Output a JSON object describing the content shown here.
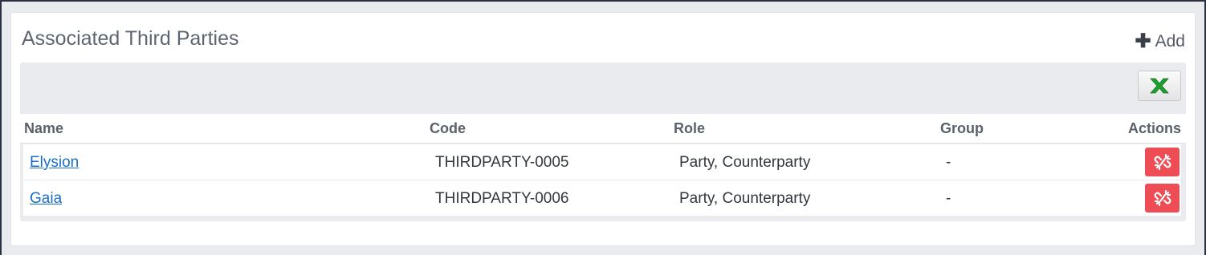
{
  "panel": {
    "title": "Associated Third Parties",
    "add_label": "Add",
    "add_icon": "plus-icon",
    "export_icon": "excel-icon"
  },
  "table": {
    "columns": [
      "Name",
      "Code",
      "Role",
      "Group",
      "Actions"
    ],
    "rows": [
      {
        "name": "Elysion",
        "code": "THIRDPARTY-0005",
        "role": "Party, Counterparty",
        "group": "-",
        "action_icon": "unlink-icon"
      },
      {
        "name": "Gaia",
        "code": "THIRDPARTY-0006",
        "role": "Party, Counterparty",
        "group": "-",
        "action_icon": "unlink-icon"
      }
    ]
  },
  "colors": {
    "link": "#1a6fc4",
    "danger": "#ef4d55",
    "excel_green": "#1e9e2f"
  }
}
